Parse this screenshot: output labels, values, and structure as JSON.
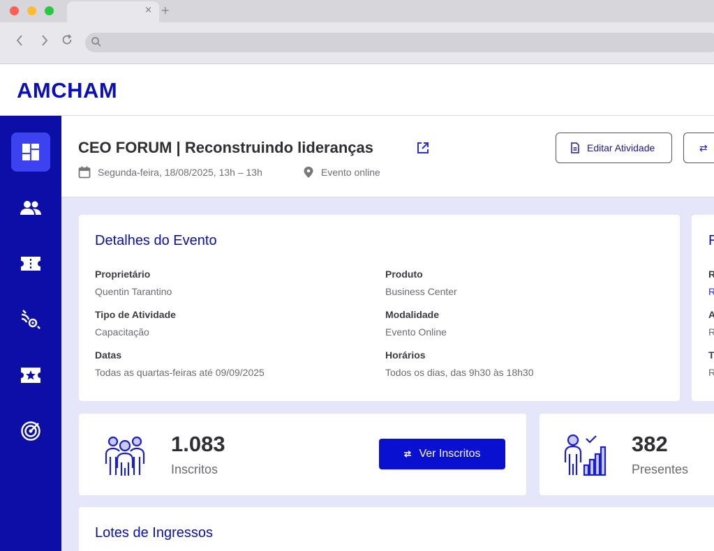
{
  "browser": {
    "tab_close": "×",
    "tab_new": "+",
    "back": "‹",
    "forward": "›",
    "reload": "↻"
  },
  "header": {
    "logo": "AMCHAM"
  },
  "sidebar": {
    "items": [
      {
        "icon": "dashboard-icon",
        "active": true
      },
      {
        "icon": "users-icon",
        "active": false
      },
      {
        "icon": "ticket-icon",
        "active": false
      },
      {
        "icon": "broadcast-icon",
        "active": false
      },
      {
        "icon": "star-ticket-icon",
        "active": false
      },
      {
        "icon": "target-icon",
        "active": false
      }
    ]
  },
  "event": {
    "title": "CEO FORUM | Reconstruindo lideranças",
    "date": "Segunda-feira, 18/08/2025, 13h – 13h",
    "location": "Evento online"
  },
  "actions": {
    "edit_label": "Editar Atividade",
    "swap_label": "⇄"
  },
  "details": {
    "title": "Detalhes do Evento",
    "fields": [
      {
        "label": "Proprietário",
        "value": "Quentin Tarantino"
      },
      {
        "label": "Produto",
        "value": "Business Center"
      },
      {
        "label": "Tipo de Atividade",
        "value": "Capacitação"
      },
      {
        "label": "Modalidade",
        "value": "Evento Online"
      },
      {
        "label": "Datas",
        "value": "Todas as quartas-feiras até 09/09/2025"
      },
      {
        "label": "Horários",
        "value": "Todos os dias, das 9h30 às 18h30"
      }
    ]
  },
  "side_card": {
    "title_letter": "R",
    "letters": [
      "R",
      "R",
      "A",
      "R",
      "T",
      "R"
    ]
  },
  "stats": {
    "inscritos": {
      "value": "1.083",
      "label": "Inscritos",
      "button": "Ver Inscritos"
    },
    "presentes": {
      "value": "382",
      "label": "Presentes"
    }
  },
  "lotes": {
    "title": "Lotes de Ingressos"
  },
  "colors": {
    "brand": "#0a0fb8",
    "sidebar": "#0b0fa6",
    "sidebar_active": "#3c42f0",
    "primary_button": "#0a10d0",
    "background": "#e6e6fa"
  }
}
